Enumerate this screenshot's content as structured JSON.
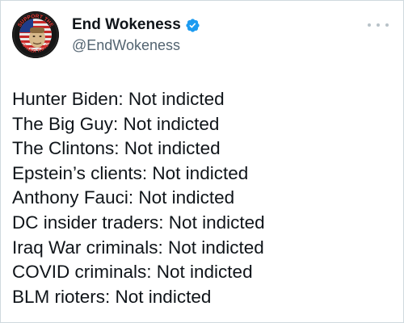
{
  "account": {
    "display_name": "End Wokeness",
    "handle": "@EndWokeness",
    "verified": true,
    "avatar_text_top": "SUPPORT THE",
    "avatar_text_bottom": "FORMER THINGS",
    "verified_color": "#1d9bf0"
  },
  "tweet": {
    "lines": [
      "Hunter Biden: Not indicted",
      "The Big Guy: Not indicted",
      "The Clintons: Not indicted",
      "Epstein’s clients: Not indicted",
      "Anthony Fauci: Not indicted",
      "DC insider traders: Not indicted",
      "Iraq War criminals: Not indicted",
      "COVID criminals: Not indicted",
      "BLM rioters: Not indicted"
    ]
  },
  "icons": {
    "more": "more-options-icon",
    "verified": "verified-badge-icon"
  }
}
